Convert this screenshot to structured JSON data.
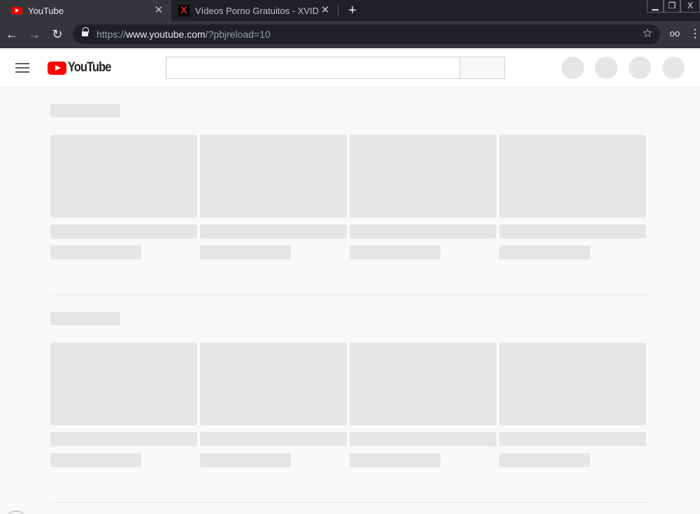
{
  "browser": {
    "tabs": [
      {
        "title": "YouTube",
        "active": true,
        "favicon": "youtube-favicon"
      },
      {
        "title": "Vídeos Porno Gratuitos - XVIDEO",
        "active": false,
        "favicon": "xvideos-favicon"
      }
    ],
    "tab_close_glyph": "✕",
    "new_tab_glyph": "+",
    "window_controls": {
      "minimize": "▁",
      "maximize": "❐",
      "close": "X"
    },
    "nav": {
      "back": "←",
      "forward": "→",
      "reload": "↻"
    },
    "address": {
      "scheme": "https://",
      "host": "www.youtube.com",
      "path": "/?pbjreload=10"
    },
    "bookmark_glyph": "☆",
    "incognito_glyph": "oo",
    "menu_glyph": "⋮"
  },
  "masthead": {
    "logo_text": "YouTube",
    "search": {
      "value": "",
      "placeholder": ""
    },
    "avatars": 4
  },
  "colors": {
    "chrome_dark": "#202124",
    "chrome_tab": "#35363a",
    "youtube_red": "#ff0000",
    "skeleton": "#e5e5e5",
    "page_bg": "#f9f9f9"
  },
  "content": {
    "sections": [
      {
        "cards": 4
      },
      {
        "cards": 4
      }
    ]
  }
}
